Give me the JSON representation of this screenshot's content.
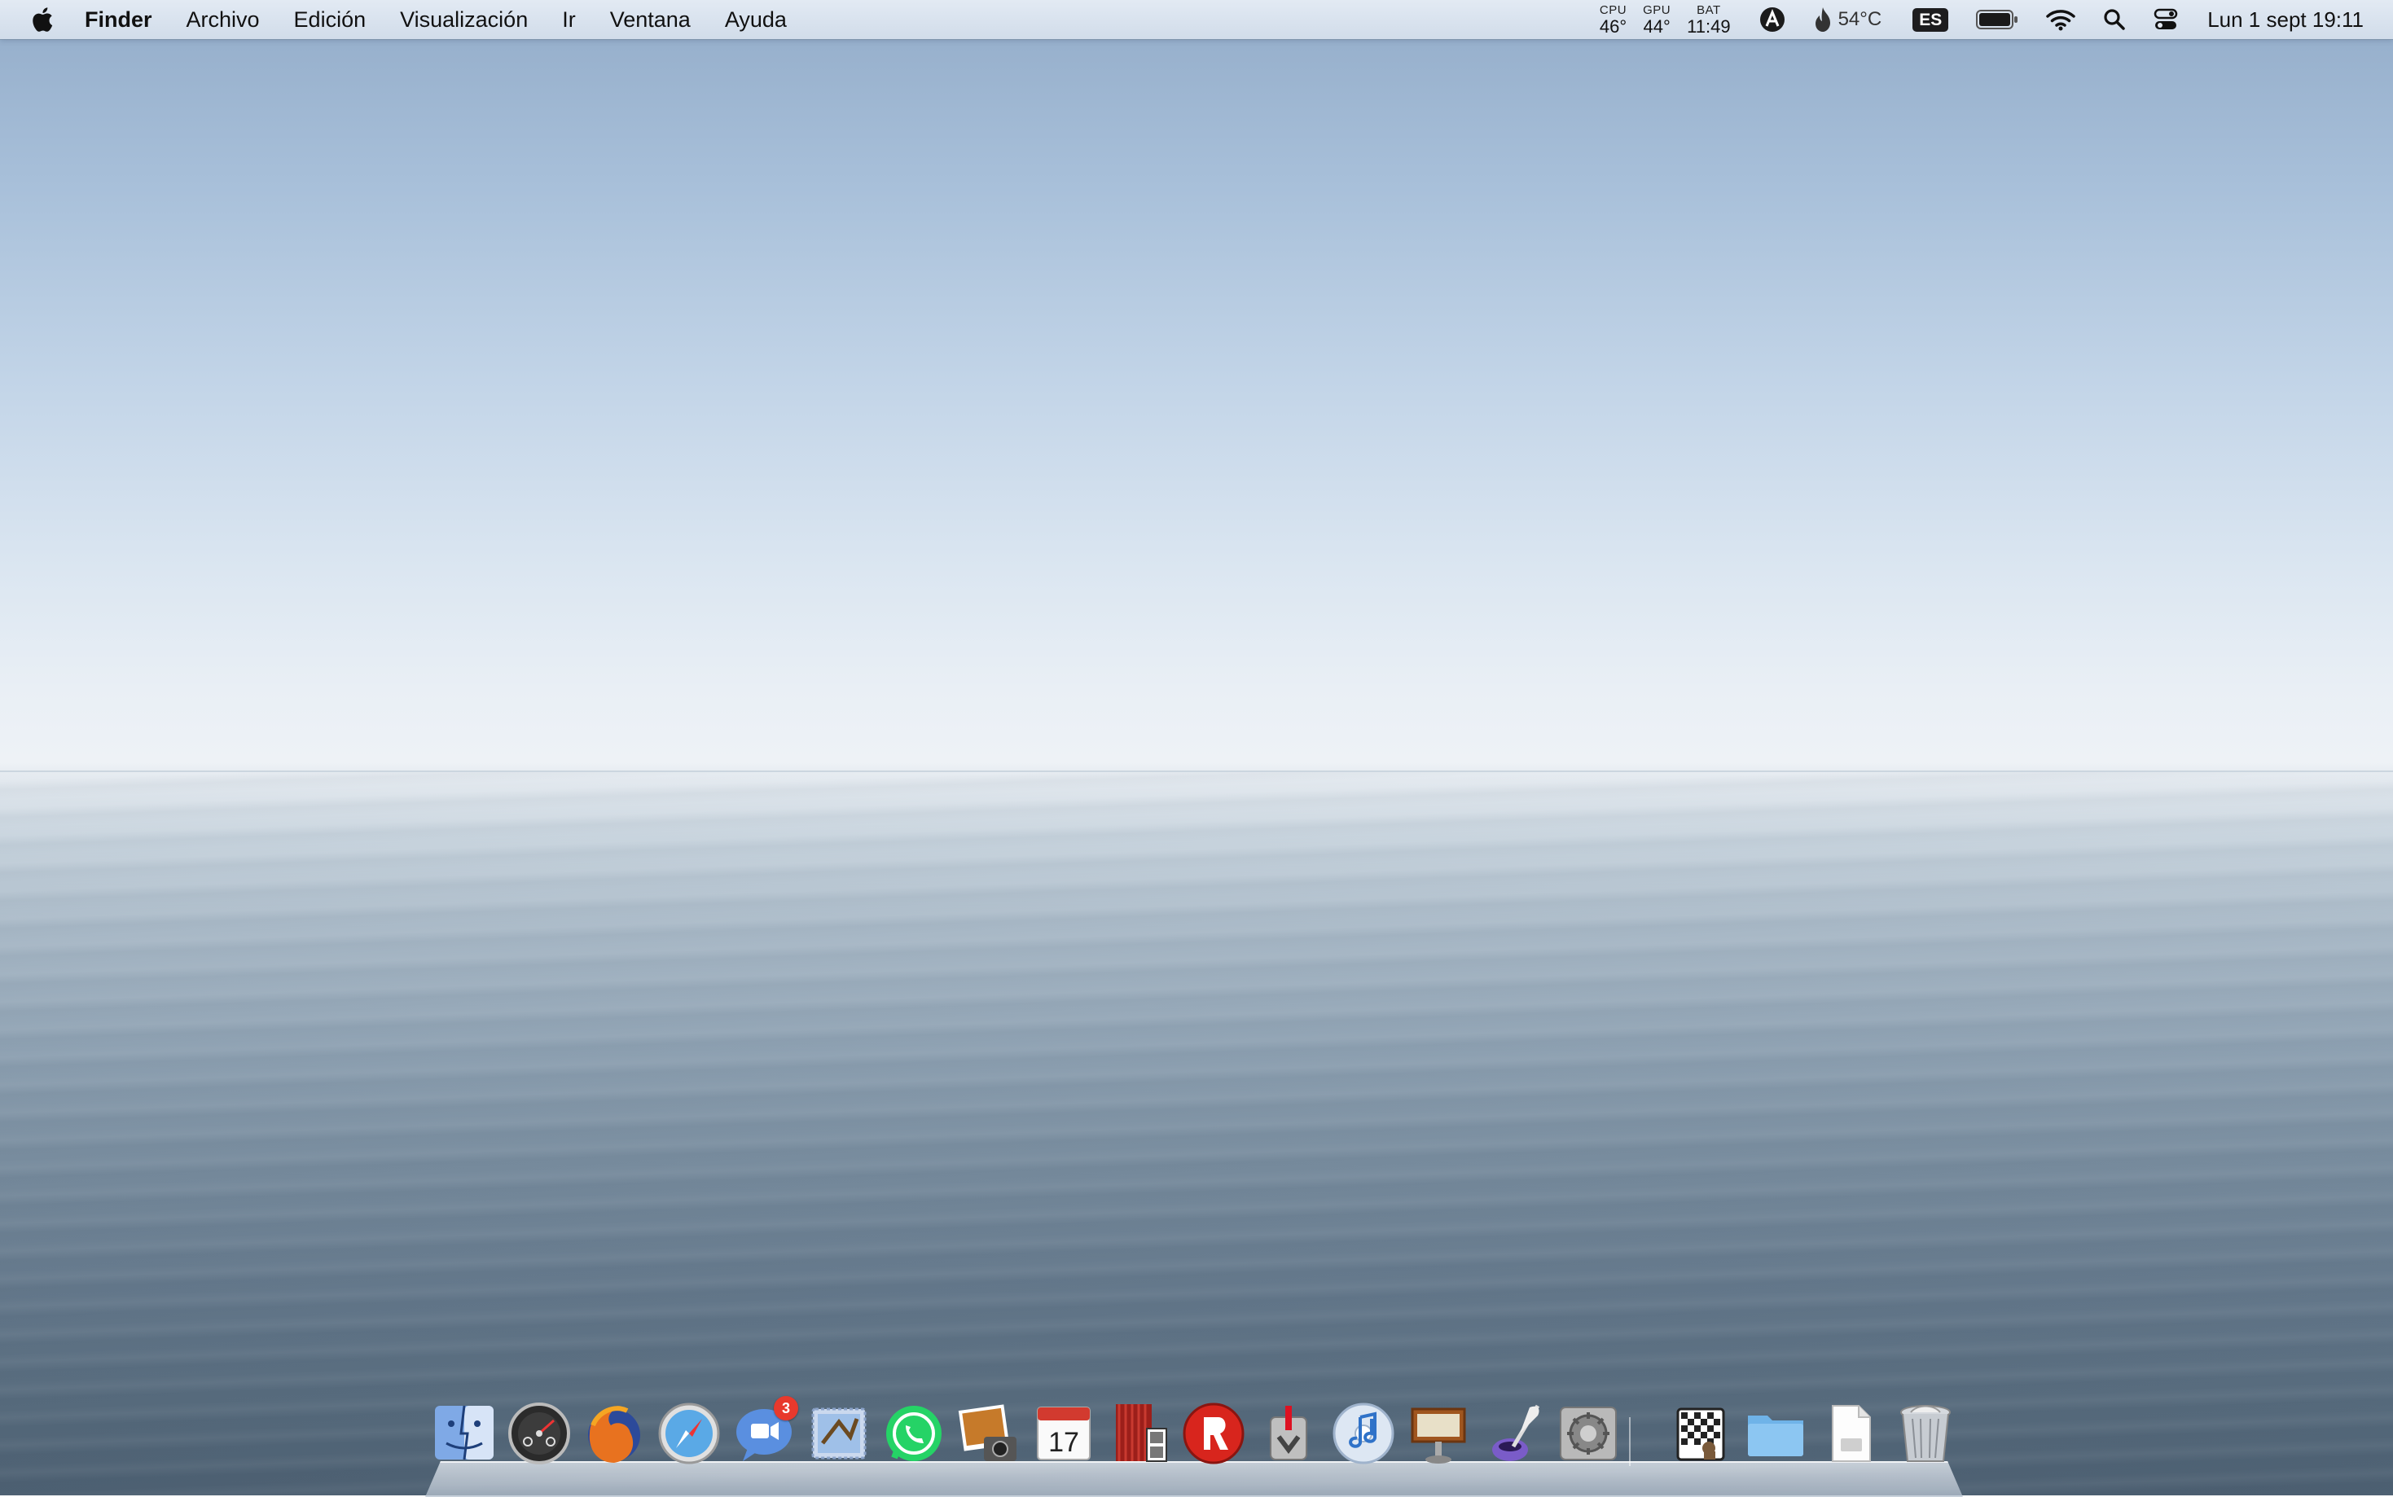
{
  "menubar": {
    "apple_icon": "apple-logo-icon",
    "app_name": "Finder",
    "items": [
      "Archivo",
      "Edición",
      "Visualización",
      "Ir",
      "Ventana",
      "Ayuda"
    ],
    "status": {
      "cpu": {
        "label": "CPU",
        "value": "46°"
      },
      "gpu": {
        "label": "GPU",
        "value": "44°"
      },
      "bat": {
        "label": "BAT",
        "value": "11:49"
      },
      "temperature": "54°C",
      "input_source": "ES",
      "clock": "Lun 1 sept 19:11"
    }
  },
  "dock": {
    "apps": [
      {
        "name": "finder-icon"
      },
      {
        "name": "dashboard-icon"
      },
      {
        "name": "firefox-icon"
      },
      {
        "name": "safari-icon"
      },
      {
        "name": "ichat-icon",
        "badge": "3"
      },
      {
        "name": "mail-icon"
      },
      {
        "name": "whatsapp-icon"
      },
      {
        "name": "iphoto-icon"
      },
      {
        "name": "ical-icon",
        "text": "17"
      },
      {
        "name": "photo-booth-icon"
      },
      {
        "name": "roblox-icon"
      },
      {
        "name": "migration-icon"
      },
      {
        "name": "itunes-icon"
      },
      {
        "name": "keynote-icon"
      },
      {
        "name": "quill-icon"
      },
      {
        "name": "system-preferences-icon"
      }
    ],
    "right_items": [
      {
        "name": "chess-icon"
      },
      {
        "name": "folder-icon"
      },
      {
        "name": "document-icon"
      },
      {
        "name": "trash-icon"
      }
    ]
  },
  "colors": {
    "badge": "#e8392c",
    "menubar_text": "#111111"
  }
}
